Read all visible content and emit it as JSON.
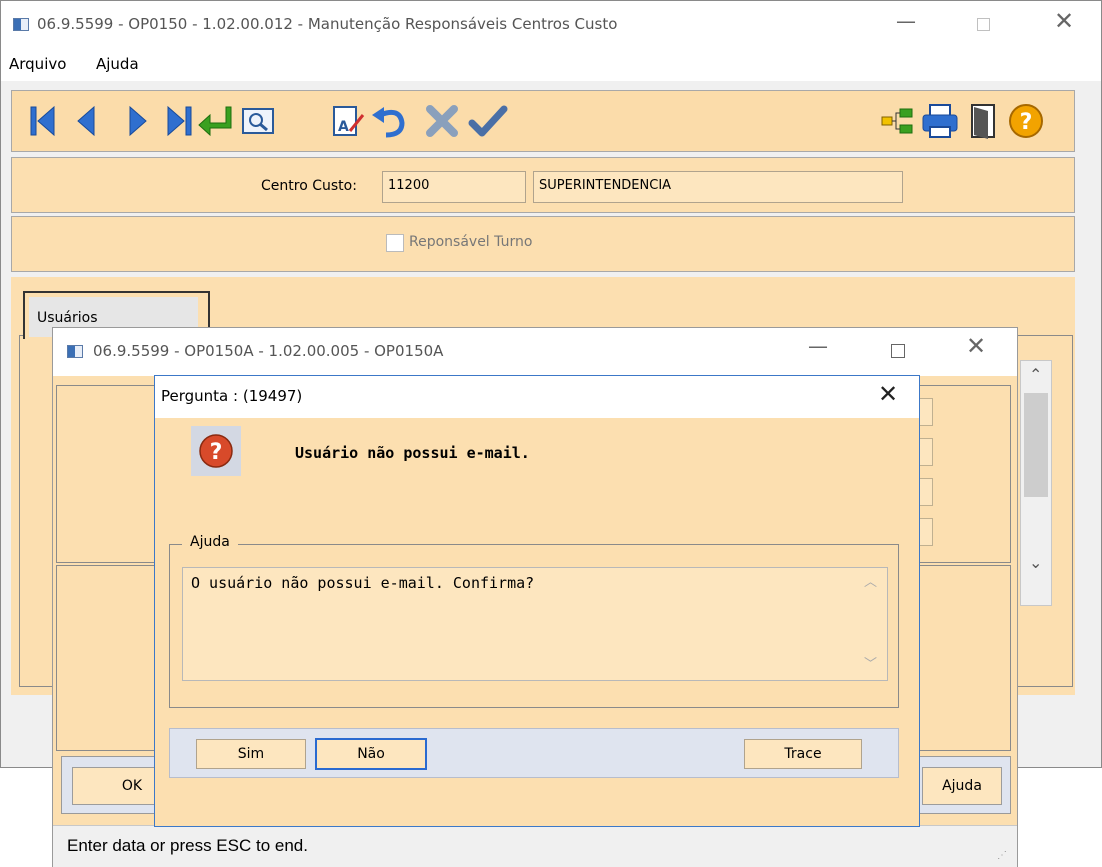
{
  "main_window": {
    "title": "06.9.5599 - OP0150 - 1.02.00.012 - Manutenção Responsáveis Centros Custo",
    "menu": [
      "Arquivo",
      "Ajuda"
    ],
    "centro_custo_label": "Centro Custo:",
    "centro_custo_code": "11200",
    "centro_custo_name": "SUPERINTENDENCIA",
    "checkbox_label": "Reponsável Turno",
    "checkbox_checked": false,
    "tab_label": "Usuários",
    "toolbar_icons": [
      "first-record-icon",
      "previous-record-icon",
      "next-record-icon",
      "last-record-icon",
      "go-to-icon",
      "search-icon",
      "edit-text-icon",
      "undo-icon",
      "delete-icon",
      "confirm-icon",
      "tree-icon",
      "print-icon",
      "exit-icon",
      "help-icon"
    ]
  },
  "sub_window": {
    "title": "06.9.5599 - OP0150A - 1.02.00.005 - OP0150A",
    "ok_label": "OK",
    "ajuda_label": "Ajuda",
    "status_text": "Enter data or press ESC to end."
  },
  "dialog": {
    "title": "Pergunta : (19497)",
    "message": "Usuário não possui e-mail.",
    "group_label": "Ajuda",
    "help_text": "O usuário não possui e-mail. Confirma?",
    "buttons": {
      "sim": "Sim",
      "nao": "Não",
      "trace": "Trace"
    }
  },
  "colors": {
    "panel": "#fcdfb0",
    "toolbar_blue": "#2f6fcf",
    "confirm_green": "#3aa020",
    "help_orange": "#f2a300",
    "question_red": "#d84a2a"
  }
}
